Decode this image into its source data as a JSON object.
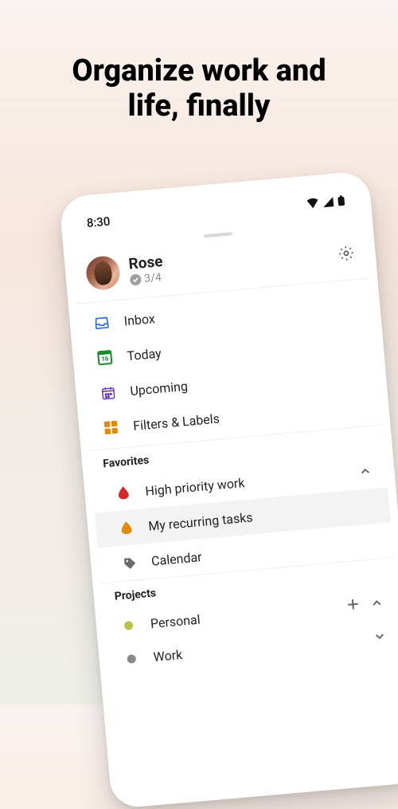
{
  "headline_l1": "Organize work and",
  "headline_l2": "life, finally",
  "status_time": "8:30",
  "user": {
    "name": "Rose",
    "progress": "3/4"
  },
  "nav": {
    "inbox": "Inbox",
    "today": "Today",
    "today_date": "16",
    "upcoming": "Upcoming",
    "filters": "Filters & Labels"
  },
  "favorites_title": "Favorites",
  "favorites": {
    "high_priority": "High priority work",
    "recurring": "My recurring tasks",
    "calendar": "Calendar"
  },
  "projects_title": "Projects",
  "projects": {
    "personal": "Personal",
    "work": "Work"
  },
  "colors": {
    "inbox": "#2a6ed6",
    "today": "#148a27",
    "upcoming": "#6b3fb7",
    "filters": "#e28b0b",
    "high_priority": "#d62a2a",
    "recurring": "#e28b0b",
    "personal": "#b6c24b",
    "work": "#8a8a8a"
  }
}
